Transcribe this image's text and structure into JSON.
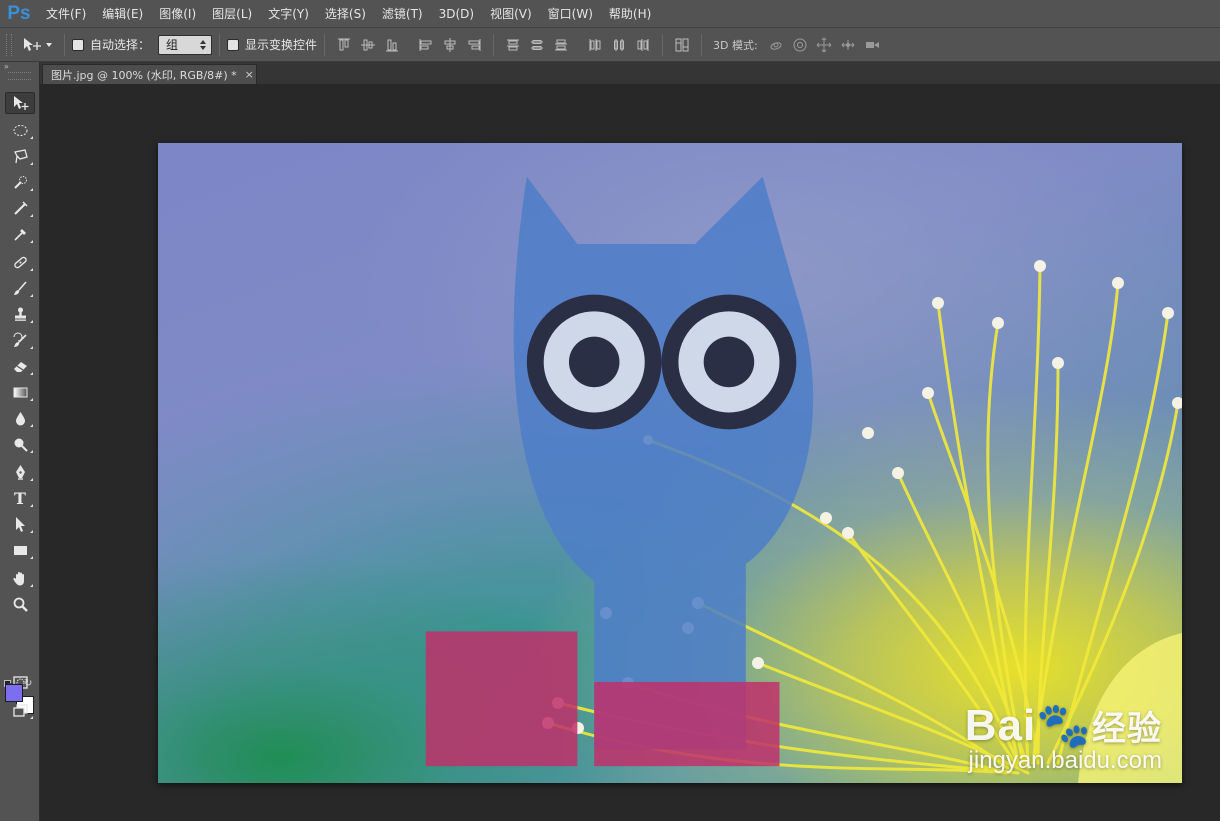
{
  "app": {
    "logo": "Ps"
  },
  "menu": [
    "文件(F)",
    "编辑(E)",
    "图像(I)",
    "图层(L)",
    "文字(Y)",
    "选择(S)",
    "滤镜(T)",
    "3D(D)",
    "视图(V)",
    "窗口(W)",
    "帮助(H)"
  ],
  "options": {
    "auto_select_label": "自动选择：",
    "auto_select_value": "组",
    "show_transform_label": "显示变换控件",
    "mode_3d_label": "3D 模式:"
  },
  "document": {
    "tab_title": "图片.jpg @ 100% (水印, RGB/8#) *",
    "close_glyph": "×"
  },
  "toolbar": {
    "head_glyph": "»",
    "text_tool_glyph": "T",
    "swap_glyph": "↻"
  },
  "colors": {
    "foreground": "#7b6ef0",
    "background": "#ffffff",
    "ui_panel": "#535353",
    "canvas_bg": "#282828"
  },
  "watermark_overlay": {
    "brand": "Bai",
    "brand_suffix": "经验",
    "url": "jingyan.baidu.com"
  }
}
